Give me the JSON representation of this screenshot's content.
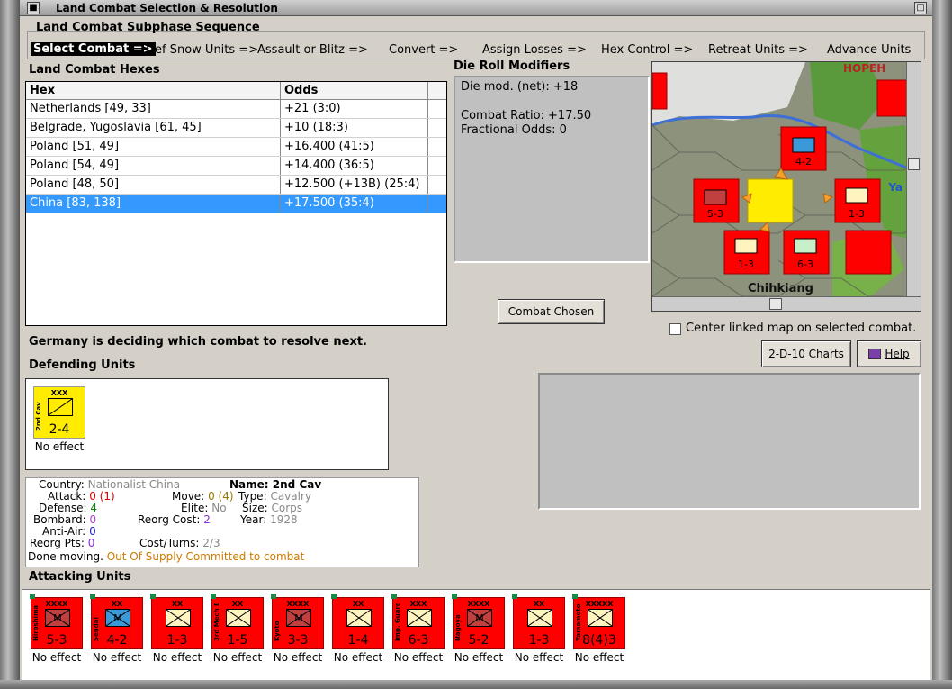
{
  "window": {
    "title": "Land Combat Selection & Resolution"
  },
  "subphase": {
    "heading": "Land Combat Subphase Sequence",
    "steps": [
      "Select Combat =>",
      "Def Snow Units =>",
      "Assault or Blitz =>",
      "Convert =>",
      "Assign Losses =>",
      "Hex Control =>",
      "Retreat Units =>",
      "Advance Units"
    ]
  },
  "hexes": {
    "heading": "Land Combat Hexes",
    "columns": [
      "Hex",
      "Odds"
    ],
    "rows": [
      {
        "hex": "Netherlands [49, 33]",
        "odds": "+21 (3:0)"
      },
      {
        "hex": "Belgrade, Yugoslavia [61, 45]",
        "odds": "+10 (18:3)"
      },
      {
        "hex": "Poland [51, 49]",
        "odds": "+16.400 (41:5)"
      },
      {
        "hex": "Poland [54, 49]",
        "odds": "+14.400 (36:5)"
      },
      {
        "hex": "Poland [48, 50]",
        "odds": "+12.500 (+13B) (25:4)"
      },
      {
        "hex": "China [83, 138]",
        "odds": "+17.500 (35:4)"
      }
    ],
    "selected_index": 5
  },
  "modifiers": {
    "heading": "Die Roll Modifiers",
    "line1": "Die mod. (net): +18",
    "line2": "Combat Ratio: +17.50",
    "line3": "Fractional Odds: 0"
  },
  "buttons": {
    "combat_chosen": "Combat Chosen",
    "charts": "2-D-10 Charts",
    "help": "Help"
  },
  "map": {
    "region_label": "HOPEH",
    "city_label": "Chihkiang",
    "river_label": "Ya",
    "center_checkbox": "Center linked map on selected combat."
  },
  "status_message": "Germany is deciding which combat to resolve next.",
  "defending": {
    "heading": "Defending Units",
    "units": [
      {
        "size": "XXX",
        "name": "2nd Cav",
        "strength": "2-4",
        "effect": "No effect",
        "color": "#ffec00"
      }
    ]
  },
  "info": {
    "country_label": "Country:",
    "country": "Nationalist China",
    "name_label": "Name:",
    "name": "2nd Cav",
    "attack_label": "Attack:",
    "attack": "0",
    "attack_extra": "(1)",
    "move_label": "Move:",
    "move": "0",
    "move_extra": "(4)",
    "type_label": "Type:",
    "type": "Cavalry",
    "defense_label": "Defense:",
    "defense": "4",
    "elite_label": "Elite:",
    "elite": "No",
    "size_label": "Size:",
    "size": "Corps",
    "bombard_label": "Bombard:",
    "bombard": "0",
    "reorg_cost_label": "Reorg Cost:",
    "reorg_cost": "2",
    "year_label": "Year:",
    "year": "1928",
    "antiair_label": "Anti-Air:",
    "antiair": "0",
    "reorg_pts_label": "Reorg Pts:",
    "reorg_pts": "0",
    "cost_turns_label": "Cost/Turns:",
    "cost_turns": "2/3",
    "done_moving": "Done moving.",
    "supply": "Out Of Supply",
    "committed": "Committed to combat"
  },
  "attacking": {
    "heading": "Attacking Units",
    "units": [
      {
        "size": "XXXX",
        "name": "Hiroshima",
        "strength": "5-3",
        "effect": "No effect",
        "symbol": "M"
      },
      {
        "size": "XX",
        "name": "Sendai",
        "strength": "4-2",
        "effect": "No effect",
        "symbol": "M"
      },
      {
        "size": "XX",
        "name": "",
        "strength": "1-3",
        "effect": "No effect",
        "symbol": ""
      },
      {
        "size": "XX",
        "name": "3rd Mech Div",
        "strength": "1-5",
        "effect": "No effect",
        "symbol": ""
      },
      {
        "size": "XXXX",
        "name": "Kyoto",
        "strength": "3-3",
        "effect": "No effect",
        "symbol": "M"
      },
      {
        "size": "XX",
        "name": "",
        "strength": "1-4",
        "effect": "No effect",
        "symbol": ""
      },
      {
        "size": "XXX",
        "name": "Imp. Guard",
        "strength": "6-3",
        "effect": "No effect",
        "symbol": ""
      },
      {
        "size": "XXXX",
        "name": "Nagoya",
        "strength": "5-2",
        "effect": "No effect",
        "symbol": "M"
      },
      {
        "size": "XX",
        "name": "",
        "strength": "1-3",
        "effect": "No effect",
        "symbol": ""
      },
      {
        "size": "XXXXX",
        "name": "Yamamoto",
        "strength": "8(4)3",
        "effect": "No effect",
        "symbol": ""
      }
    ]
  },
  "colors": {
    "selection": "#3399ff",
    "counter_red": "#ff0000",
    "supply_orange": "#cc7a00",
    "purple_value": "#8a2be2"
  }
}
